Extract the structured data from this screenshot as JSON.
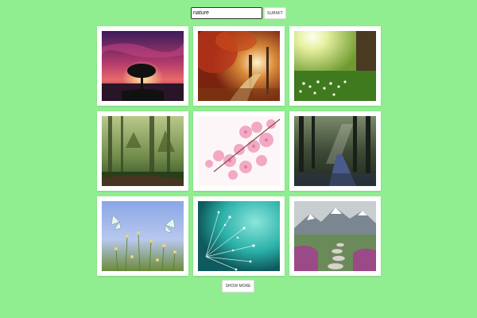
{
  "search": {
    "value": "nature",
    "submit_label": "SUBMIT"
  },
  "gallery": {
    "images": [
      {
        "subject": "tree-sunset"
      },
      {
        "subject": "autumn-forest-path"
      },
      {
        "subject": "sunlit-meadow-flowers"
      },
      {
        "subject": "misty-forest"
      },
      {
        "subject": "pink-cherry-blossoms"
      },
      {
        "subject": "forest-road-light-rays"
      },
      {
        "subject": "butterflies-wildflowers"
      },
      {
        "subject": "dewy-dandelion-seeds"
      },
      {
        "subject": "mountain-stone-path"
      }
    ]
  },
  "footer": {
    "show_more_label": "SHOW MORE"
  }
}
